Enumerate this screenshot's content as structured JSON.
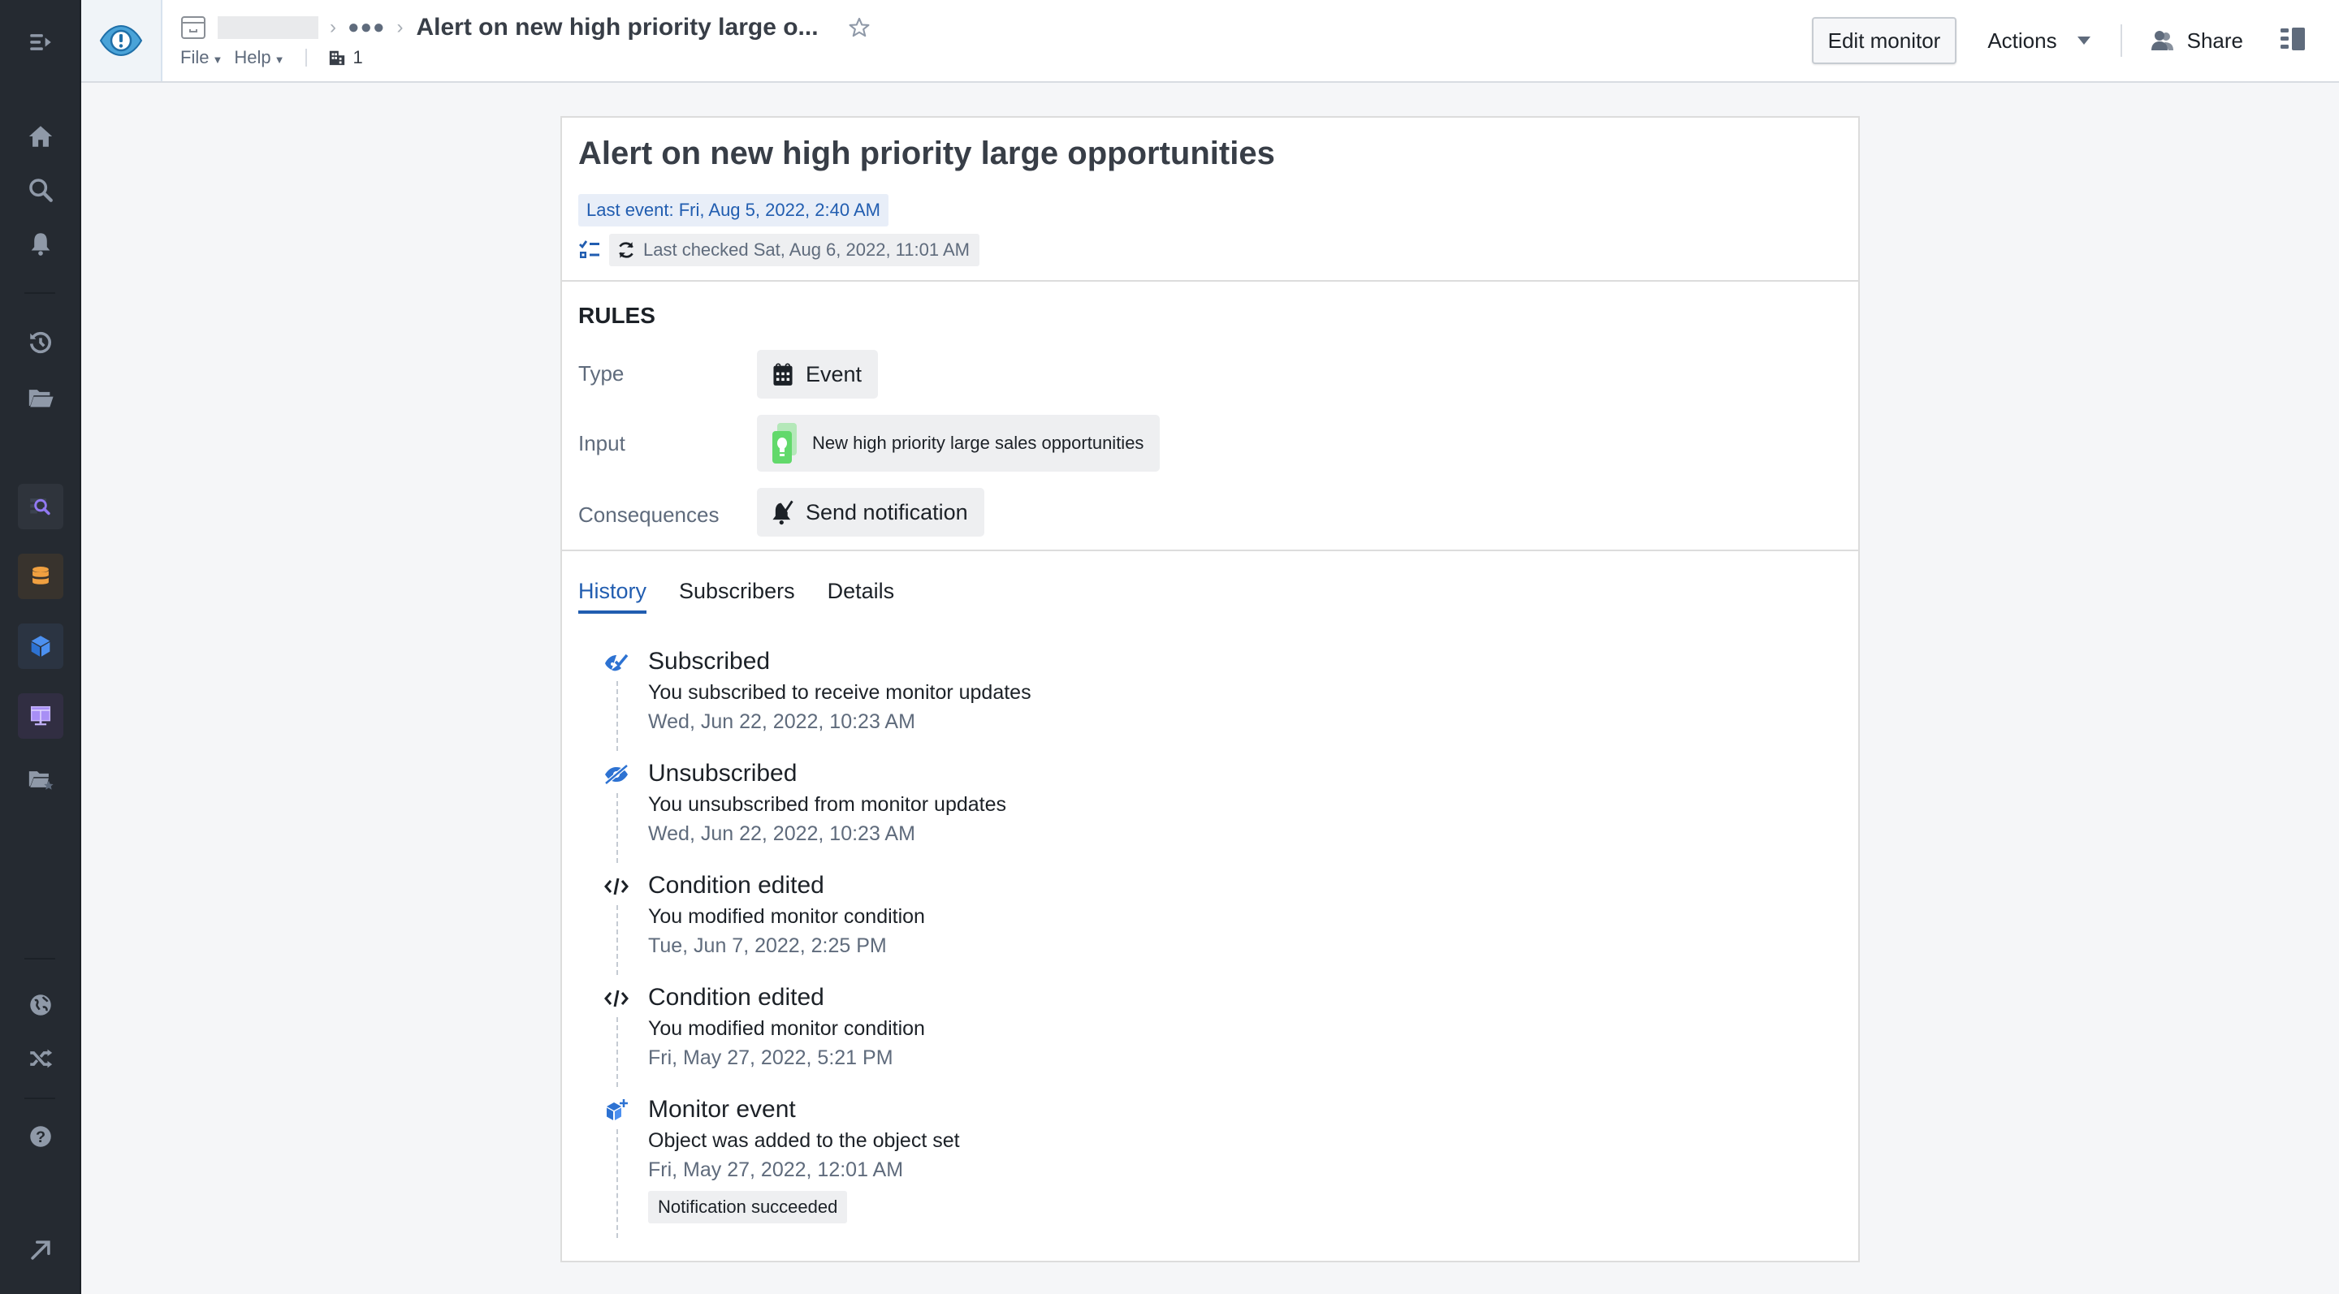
{
  "header": {
    "breadcrumb_title": "Alert on new high priority large o...",
    "menus": [
      {
        "label": "File"
      },
      {
        "label": "Help"
      }
    ],
    "workspace_count": "1",
    "edit_button": "Edit monitor",
    "actions_button": "Actions",
    "share_button": "Share"
  },
  "nav": {
    "items": [
      "home-icon",
      "search-icon",
      "notifications-icon",
      "history-icon",
      "folder-icon",
      "object-explorer-icon",
      "datasets-icon",
      "ontology-icon",
      "workshop-icon",
      "favorites-folder-icon",
      "globe-icon",
      "shuffle-icon",
      "help-icon",
      "expand-icon"
    ]
  },
  "monitor": {
    "title": "Alert on new high priority large opportunities",
    "last_event": "Last event: Fri, Aug 5, 2022, 2:40 AM",
    "last_checked": "Last checked Sat, Aug 6, 2022, 11:01 AM"
  },
  "rules": {
    "heading": "RULES",
    "type_label": "Type",
    "type_value": "Event",
    "input_label": "Input",
    "input_value": "New high priority large sales opportunities",
    "consequences_label": "Consequences",
    "consequences_value": "Send notification"
  },
  "tabs": [
    {
      "label": "History",
      "active": true
    },
    {
      "label": "Subscribers",
      "active": false
    },
    {
      "label": "Details",
      "active": false
    }
  ],
  "history": [
    {
      "icon": "subscribed-eye-icon",
      "title": "Subscribed",
      "desc": "You subscribed to receive monitor updates",
      "time": "Wed, Jun 22, 2022, 10:23 AM"
    },
    {
      "icon": "unsubscribed-eye-icon",
      "title": "Unsubscribed",
      "desc": "You unsubscribed from monitor updates",
      "time": "Wed, Jun 22, 2022, 10:23 AM"
    },
    {
      "icon": "code-icon",
      "title": "Condition edited",
      "desc": "You modified monitor condition",
      "time": "Tue, Jun 7, 2022, 2:25 PM"
    },
    {
      "icon": "code-icon",
      "title": "Condition edited",
      "desc": "You modified monitor condition",
      "time": "Fri, May 27, 2022, 5:21 PM"
    },
    {
      "icon": "cube-add-icon",
      "title": "Monitor event",
      "desc": "Object was added to the object set",
      "time": "Fri, May 27, 2022, 12:01 AM",
      "badge": "Notification succeeded"
    }
  ],
  "colors": {
    "accent": "#215db0",
    "nav_bg": "#252a31",
    "icon_gray": "#8f99a8",
    "input_green": "#62d96b"
  }
}
